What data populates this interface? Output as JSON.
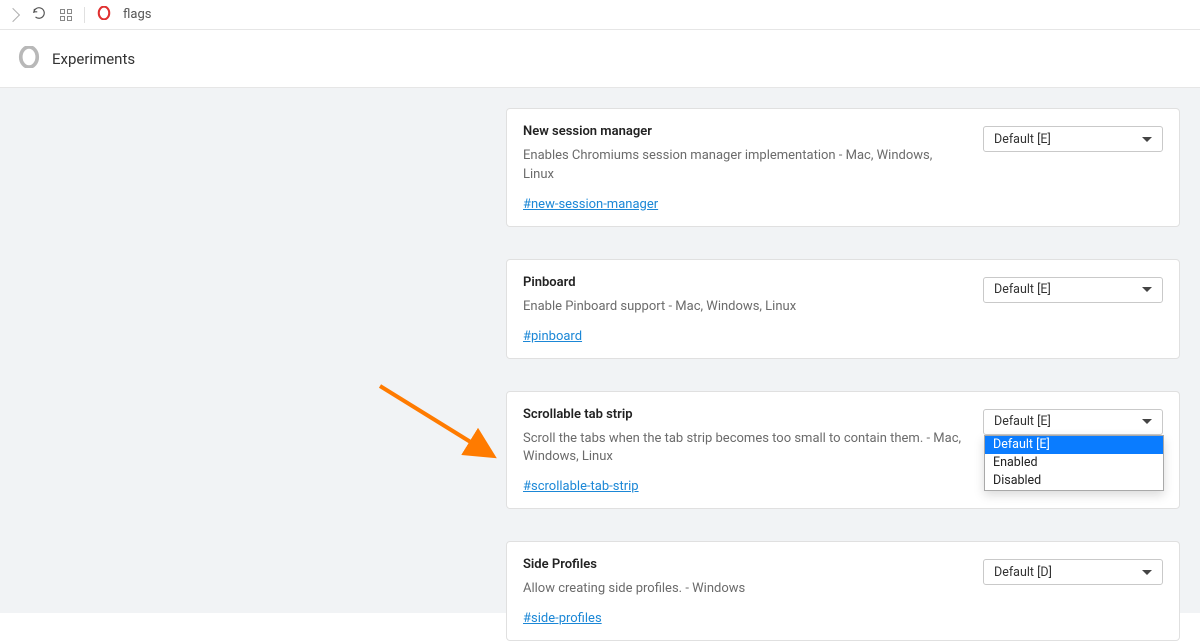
{
  "toolbar": {
    "url": "flags"
  },
  "header": {
    "title": "Experiments"
  },
  "flags": [
    {
      "title": "New session manager",
      "description": "Enables Chromiums session manager implementation - Mac, Windows, Linux",
      "link": "#new-session-manager",
      "selected": "Default [E]"
    },
    {
      "title": "Pinboard",
      "description": "Enable Pinboard support - Mac, Windows, Linux",
      "link": "#pinboard",
      "selected": "Default [E]"
    },
    {
      "title": "Scrollable tab strip",
      "description": "Scroll the tabs when the tab strip becomes too small to contain them. - Mac, Windows, Linux",
      "link": "#scrollable-tab-strip",
      "selected": "Default [E]",
      "dropdown_open": true,
      "options": [
        "Default [E]",
        "Enabled",
        "Disabled"
      ]
    },
    {
      "title": "Side Profiles",
      "description": "Allow creating side profiles. - Windows",
      "link": "#side-profiles",
      "selected": "Default [D]"
    }
  ]
}
